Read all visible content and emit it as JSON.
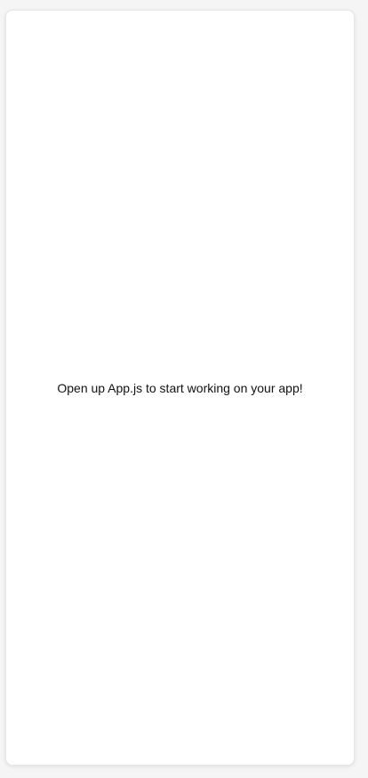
{
  "app": {
    "message": "Open up App.js to start working on your app!"
  },
  "colors": {
    "background": "#f5f5f5",
    "surface": "#ffffff",
    "text": "#111111"
  }
}
